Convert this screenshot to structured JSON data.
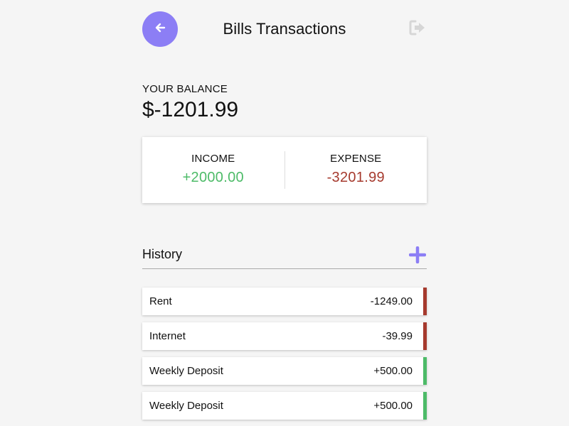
{
  "header": {
    "title": "Bills Transactions",
    "back_icon": "arrow-left-icon",
    "logout_icon": "sign-out-icon",
    "accent_color": "#8c7ef5"
  },
  "balance": {
    "label": "YOUR BALANCE",
    "amount": "$-1201.99"
  },
  "summary": {
    "income_label": "INCOME",
    "income_value": "+2000.00",
    "expense_label": "EXPENSE",
    "expense_value": "-3201.99",
    "income_color": "#4dbb68",
    "expense_color": "#a63a2e"
  },
  "history": {
    "title": "History",
    "add_icon": "plus-icon",
    "items": [
      {
        "name": "Rent",
        "amount": "-1249.00",
        "type": "expense"
      },
      {
        "name": "Internet",
        "amount": "-39.99",
        "type": "expense"
      },
      {
        "name": "Weekly Deposit",
        "amount": "+500.00",
        "type": "income"
      },
      {
        "name": "Weekly Deposit",
        "amount": "+500.00",
        "type": "income"
      }
    ]
  }
}
